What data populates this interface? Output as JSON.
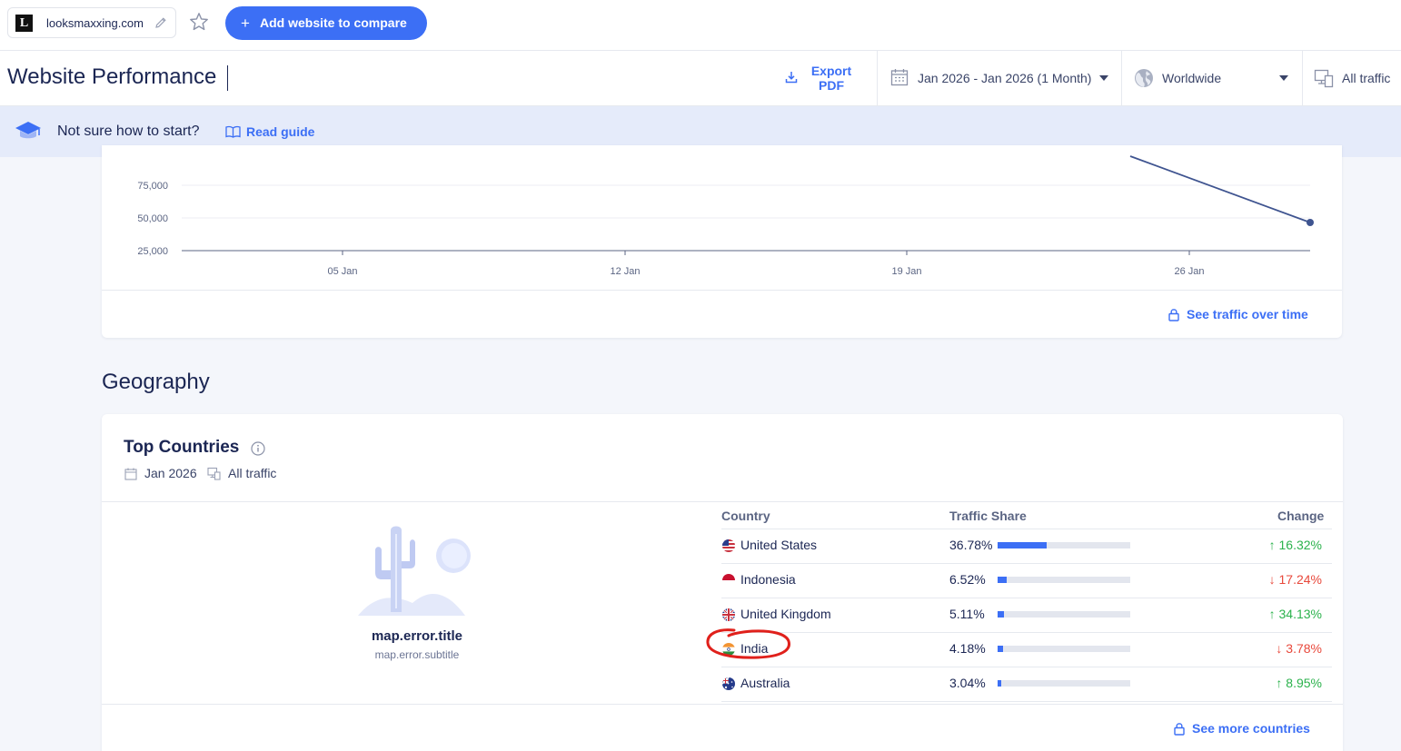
{
  "topbar": {
    "site_logo_letter": "L",
    "site_name": "looksmaxxing.com",
    "add_button_label": "Add website to compare"
  },
  "header": {
    "title": "Website Performance",
    "export_label_line1": "Export",
    "export_label_line2": "PDF",
    "date_range": "Jan 2026 - Jan 2026 (1 Month)",
    "region": "Worldwide",
    "traffic_type": "All traffic"
  },
  "banner": {
    "text": "Not sure how to start?",
    "link": "Read guide"
  },
  "traffic_card": {
    "link": "See traffic over time",
    "chart_data": {
      "type": "line",
      "y_ticks": [
        "75,000",
        "50,000",
        "25,000"
      ],
      "x_ticks": [
        "05 Jan",
        "12 Jan",
        "19 Jan",
        "26 Jan"
      ],
      "line_color": "#3f5490"
    }
  },
  "geography": {
    "section_title": "Geography",
    "card_title": "Top Countries",
    "date": "Jan 2026",
    "traffic_type": "All traffic",
    "map_error_title": "map.error.title",
    "map_error_subtitle": "map.error.subtitle",
    "columns": {
      "country": "Country",
      "share": "Traffic Share",
      "change": "Change"
    },
    "rows": [
      {
        "country": "United States",
        "share": "36.78%",
        "share_value": 36.78,
        "change": "16.32%",
        "direction": "up",
        "flag": "us-flag-icon"
      },
      {
        "country": "Indonesia",
        "share": "6.52%",
        "share_value": 6.52,
        "change": "17.24%",
        "direction": "down",
        "flag": "id-flag-icon"
      },
      {
        "country": "United Kingdom",
        "share": "5.11%",
        "share_value": 5.11,
        "change": "34.13%",
        "direction": "up",
        "flag": "gb-flag-icon"
      },
      {
        "country": "India",
        "share": "4.18%",
        "share_value": 4.18,
        "change": "3.78%",
        "direction": "down",
        "flag": "in-flag-icon"
      },
      {
        "country": "Australia",
        "share": "3.04%",
        "share_value": 3.04,
        "change": "8.95%",
        "direction": "up",
        "flag": "au-flag-icon"
      }
    ],
    "see_more": "See more countries"
  },
  "colors": {
    "accent": "#3c6ff5",
    "up": "#2bb24c",
    "down": "#e8483b",
    "annotation": "#e0201b"
  }
}
